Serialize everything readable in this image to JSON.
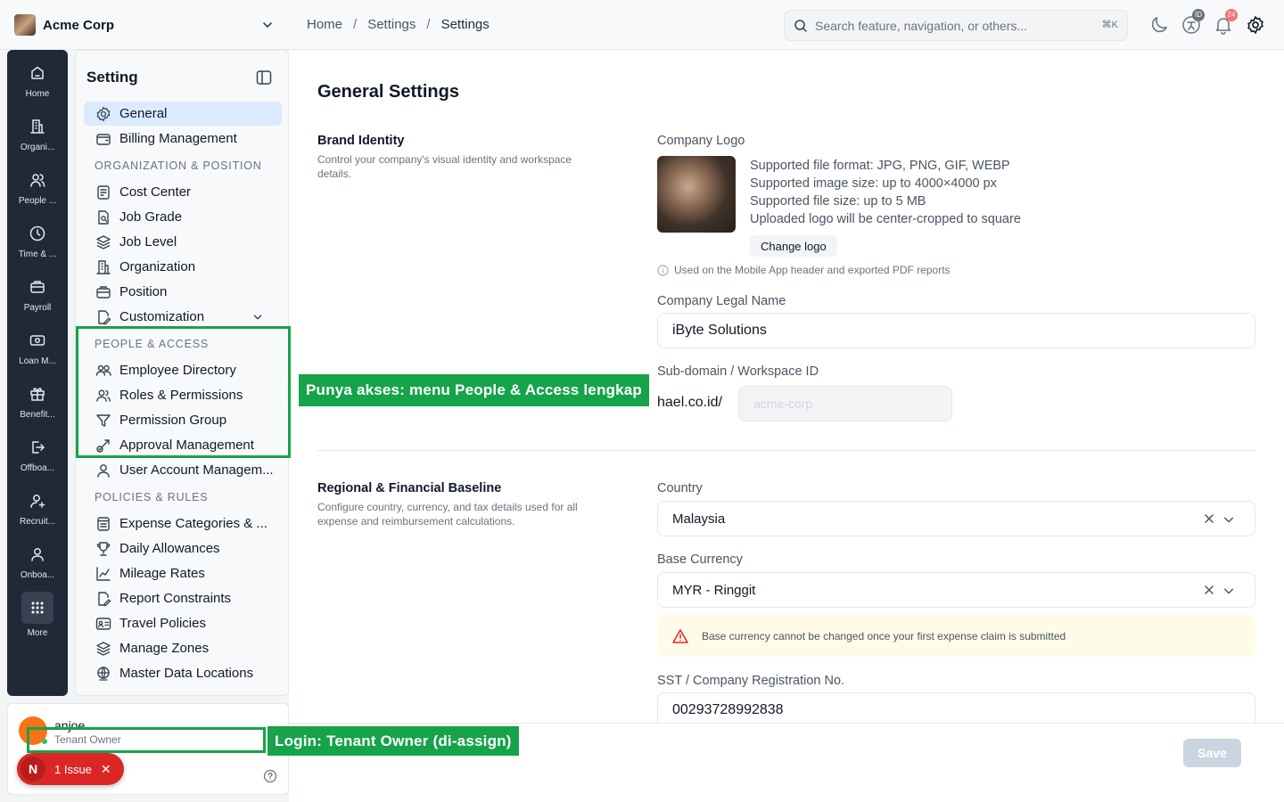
{
  "topbar": {
    "org_name": "Acme Corp",
    "breadcrumb": [
      "Home",
      "Settings",
      "Settings"
    ],
    "search_placeholder": "Search feature, navigation, or others...",
    "search_shortcut": "⌘K",
    "id_badge": "ID",
    "notification_count": "24"
  },
  "rail": {
    "items": [
      "Home",
      "Organi...",
      "People ...",
      "Time & ...",
      "Payroll",
      "Loan M...",
      "Benefit...",
      "Offboa...",
      "Recruit...",
      "Onboa...",
      "More"
    ]
  },
  "settings_nav": {
    "title": "Setting",
    "items": {
      "general": "General",
      "billing": "Billing Management",
      "cost_center": "Cost Center",
      "job_grade": "Job Grade",
      "job_level": "Job Level",
      "organization": "Organization",
      "position": "Position",
      "customization": "Customization",
      "employee_directory": "Employee Directory",
      "roles_permissions": "Roles & Permissions",
      "permission_group": "Permission Group",
      "approval_management": "Approval Management",
      "user_account": "User Account Managem...",
      "expense_categories": "Expense Categories & ...",
      "daily_allowances": "Daily Allowances",
      "mileage_rates": "Mileage Rates",
      "report_constraints": "Report Constraints",
      "travel_policies": "Travel Policies",
      "manage_zones": "Manage Zones",
      "master_data_locations": "Master Data Locations"
    },
    "sections": {
      "org_position": "ORGANIZATION & POSITION",
      "people_access": "PEOPLE & ACCESS",
      "policies_rules": "POLICIES & RULES"
    }
  },
  "user": {
    "name": "anjoe",
    "role": "Tenant Owner",
    "issue_initial": "N",
    "issue_label": "1 Issue",
    "issue_close": "✕"
  },
  "main": {
    "title": "General Settings",
    "brand": {
      "title": "Brand Identity",
      "desc": "Control your company's visual identity and workspace details.",
      "logo_label": "Company Logo",
      "logo_info": [
        "Supported file format: JPG, PNG, GIF, WEBP",
        "Supported image size: up to 4000×4000 px",
        "Supported file size: up to 5 MB",
        "Uploaded logo will be center-cropped to square"
      ],
      "change_logo": "Change logo",
      "logo_note": "Used on the Mobile App header and exported PDF reports",
      "legal_name_label": "Company Legal Name",
      "legal_name_value": "iByte Solutions",
      "subdomain_label": "Sub-domain / Workspace ID",
      "subdomain_prefix": "hael.co.id/",
      "subdomain_placeholder": "acme-corp"
    },
    "regional": {
      "title": "Regional & Financial Baseline",
      "desc": "Configure country, currency, and tax details used for all expense and reimbursement calculations.",
      "country_label": "Country",
      "country_value": "Malaysia",
      "currency_label": "Base Currency",
      "currency_value": "MYR - Ringgit",
      "currency_warning": "Base currency cannot be changed once your first expense claim is submitted",
      "sst_label": "SST / Company Registration No.",
      "sst_value": "00293728992838"
    },
    "save_label": "Save"
  },
  "annotations": {
    "people_access": "Punya akses: menu People & Access lengkap",
    "login": "Login: Tenant Owner (di-assign)"
  },
  "colors": {
    "annotation_green": "#16a34a",
    "active_nav": "#dbeafe",
    "rail_bg": "#1f2937",
    "issue_red": "#dc2626",
    "notification_red": "#f87171"
  }
}
